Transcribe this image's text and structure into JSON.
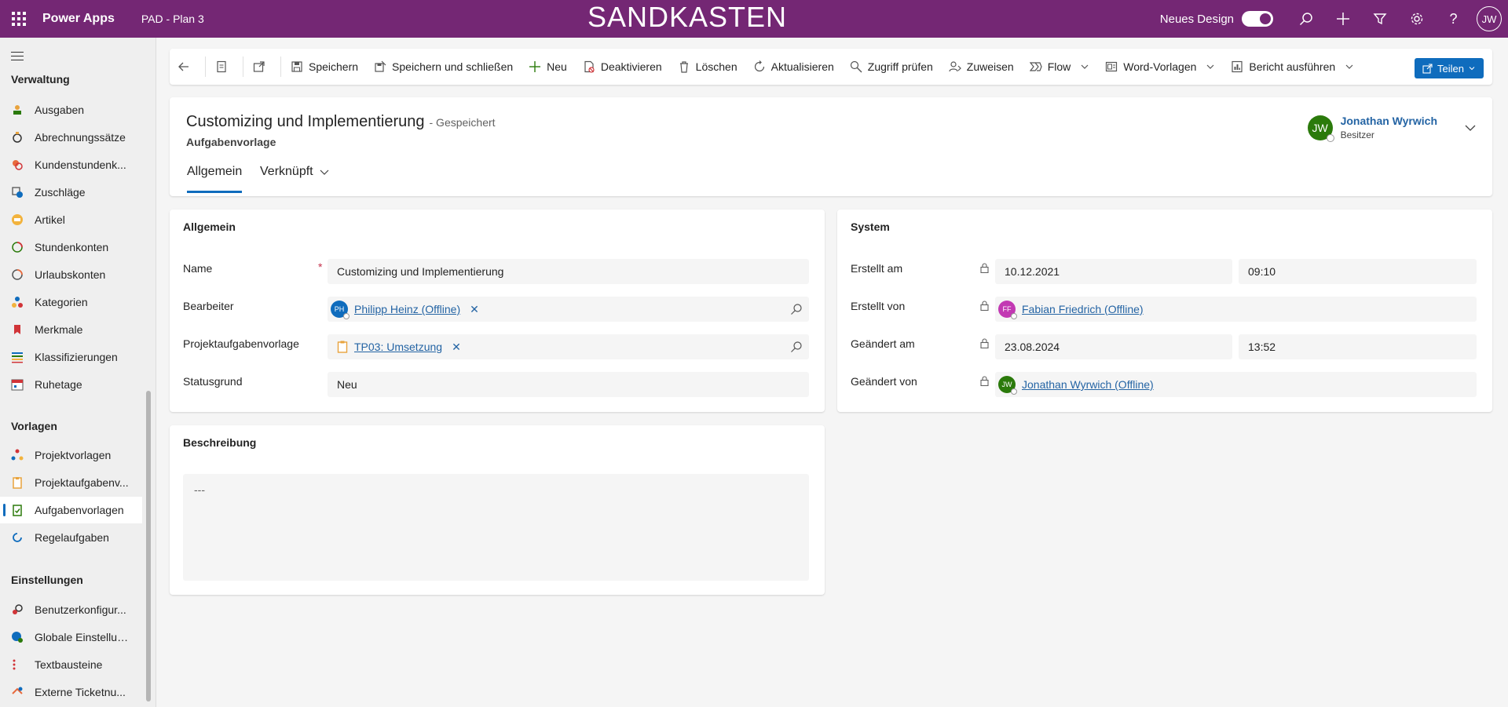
{
  "topbar": {
    "app_name": "Power Apps",
    "environment": "PAD - Plan 3",
    "banner": "SANDKASTEN",
    "new_design_label": "Neues Design",
    "user_initials": "JW"
  },
  "sidebar": {
    "groups": [
      {
        "title": "Verwaltung",
        "items": [
          "Ausgaben",
          "Abrechnungssätze",
          "Kundenstundenk...",
          "Zuschläge",
          "Artikel",
          "Stundenkonten",
          "Urlaubskonten",
          "Kategorien",
          "Merkmale",
          "Klassifizierungen",
          "Ruhetage"
        ]
      },
      {
        "title": "Vorlagen",
        "items": [
          "Projektvorlagen",
          "Projektaufgabenv...",
          "Aufgabenvorlagen",
          "Regelaufgaben"
        ]
      },
      {
        "title": "Einstellungen",
        "items": [
          "Benutzerkonfigur...",
          "Globale Einstellun...",
          "Textbausteine",
          "Externe Ticketnu..."
        ]
      }
    ],
    "active_item": "Aufgabenvorlagen"
  },
  "commands": {
    "save": "Speichern",
    "save_close": "Speichern und schließen",
    "new": "Neu",
    "deactivate": "Deaktivieren",
    "delete": "Löschen",
    "refresh": "Aktualisieren",
    "check_access": "Zugriff prüfen",
    "assign": "Zuweisen",
    "flow": "Flow",
    "word_templates": "Word-Vorlagen",
    "run_report": "Bericht ausführen",
    "share": "Teilen"
  },
  "record": {
    "title": "Customizing und Implementierung",
    "status": "- Gespeichert",
    "entity": "Aufgabenvorlage",
    "tabs": {
      "general": "Allgemein",
      "related": "Verknüpft"
    },
    "owner_name": "Jonathan Wyrwich",
    "owner_role": "Besitzer",
    "owner_initials": "JW"
  },
  "general": {
    "title": "Allgemein",
    "name_label": "Name",
    "name_value": "Customizing und Implementierung",
    "editor_label": "Bearbeiter",
    "editor_value": "Philipp Heinz (Offline)",
    "editor_initials": "PH",
    "project_task_label": "Projektaufgabenvorlage",
    "project_task_value": "TP03: Umsetzung",
    "status_reason_label": "Statusgrund",
    "status_reason_value": "Neu"
  },
  "system": {
    "title": "System",
    "created_on_label": "Erstellt am",
    "created_on_date": "10.12.2021",
    "created_on_time": "09:10",
    "created_by_label": "Erstellt von",
    "created_by_value": "Fabian Friedrich (Offline)",
    "created_by_initials": "FF",
    "modified_on_label": "Geändert am",
    "modified_on_date": "23.08.2024",
    "modified_on_time": "13:52",
    "modified_by_label": "Geändert von",
    "modified_by_value": "Jonathan Wyrwich (Offline)",
    "modified_by_initials": "JW"
  },
  "description": {
    "title": "Beschreibung",
    "value": "---"
  },
  "colors": {
    "header_purple": "#742774",
    "primary_blue": "#0f6cbd",
    "link_blue": "#2464a4",
    "owner_green": "#2b7a0b",
    "ff_magenta": "#c239b3"
  }
}
